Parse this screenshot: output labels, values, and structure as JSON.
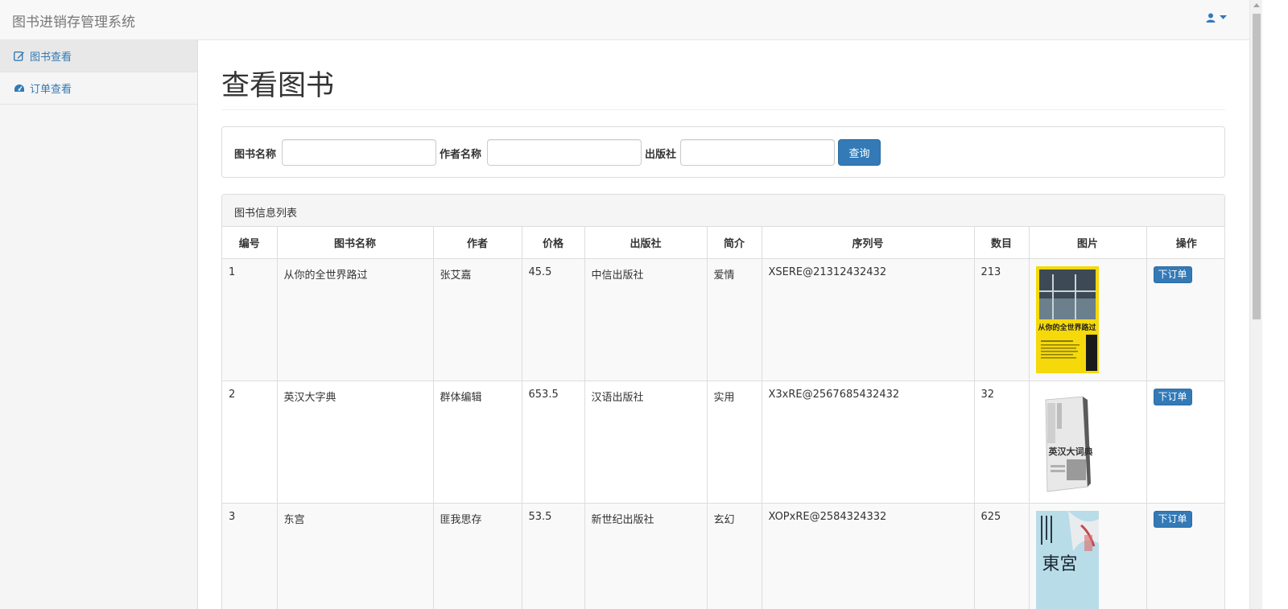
{
  "app": {
    "title": "图书进销存管理系统"
  },
  "user_menu": {
    "icon": "user-icon",
    "caret": "caret-down-icon"
  },
  "sidebar": {
    "items": [
      {
        "label": "图书查看",
        "icon": "edit-icon",
        "active": true
      },
      {
        "label": "订单查看",
        "icon": "dashboard-icon",
        "active": false
      }
    ]
  },
  "page": {
    "title": "查看图书"
  },
  "search": {
    "book_name_label": "图书名称",
    "book_name_value": "",
    "author_label": "作者名称",
    "author_value": "",
    "publisher_label": "出版社",
    "publisher_value": "",
    "query_button": "查询"
  },
  "book_list": {
    "heading": "图书信息列表",
    "columns": [
      "编号",
      "图书名称",
      "作者",
      "价格",
      "出版社",
      "简介",
      "序列号",
      "数目",
      "图片",
      "操作"
    ],
    "rows": [
      {
        "id": "1",
        "name": "从你的全世界路过",
        "author": "张艾嘉",
        "price": "45.5",
        "publisher": "中信出版社",
        "intro": "爱情",
        "serial": "XSERE@21312432432",
        "count": "213",
        "cover_title": "从你的全世界路过",
        "action": "下订单"
      },
      {
        "id": "2",
        "name": "英汉大字典",
        "author": "群体编辑",
        "price": "653.5",
        "publisher": "汉语出版社",
        "intro": "实用",
        "serial": "X3xRE@2567685432432",
        "count": "32",
        "cover_title": "英汉大词典",
        "action": "下订单"
      },
      {
        "id": "3",
        "name": "东宫",
        "author": "匪我思存",
        "price": "53.5",
        "publisher": "新世纪出版社",
        "intro": "玄幻",
        "serial": "XOPxRE@2584324332",
        "count": "625",
        "cover_title": "東宮",
        "action": "下订单"
      }
    ]
  },
  "colors": {
    "primary": "#337ab7",
    "navbar_bg": "#f8f8f8",
    "sidebar_bg": "#f5f5f5",
    "cover1_bg": "#f5d90a",
    "cover3_bg": "#b9dde8"
  }
}
